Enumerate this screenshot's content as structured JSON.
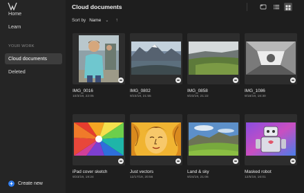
{
  "sidebar": {
    "items": [
      {
        "label": "Home"
      },
      {
        "label": "Learn"
      }
    ],
    "section_label": "YOUR WORK",
    "work_items": [
      {
        "label": "Cloud documents",
        "active": true
      },
      {
        "label": "Deleted"
      }
    ],
    "create_label": "Create new",
    "create_icon": "plus-circle-icon"
  },
  "header": {
    "title": "Cloud documents",
    "sort_label": "Sort by",
    "sort_value": "Name",
    "sort_direction_icon": "arrow-up-icon",
    "view_icons": [
      "folder-sync-icon",
      "list-view-icon",
      "grid-view-icon"
    ],
    "active_view": "grid"
  },
  "documents": [
    {
      "name": "IMG_0016",
      "date": "10/3/19, 22:05"
    },
    {
      "name": "IMG_0802",
      "date": "9/23/19, 21:55"
    },
    {
      "name": "IMG_0858",
      "date": "9/23/19, 21:22"
    },
    {
      "name": "IMG_1086",
      "date": "9/18/19, 16:30"
    },
    {
      "name": "iPad cover sketch",
      "date": "9/23/19, 19:24"
    },
    {
      "name": "Just vectors",
      "date": "12/17/19, 20:56"
    },
    {
      "name": "Land & sky",
      "date": "9/24/19, 21:06"
    },
    {
      "name": "Masked robot",
      "date": "12/5/19, 16:01"
    }
  ],
  "colors": {
    "background": "#1e1e1e",
    "sidebar": "#252525",
    "active_item": "#3d3d3d",
    "accent": "#2f7bea",
    "card": "#2d2d2d"
  }
}
